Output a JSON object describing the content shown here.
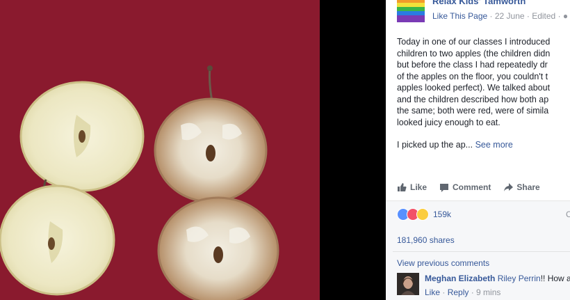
{
  "post": {
    "page_name": "Relax Kids' Tamworth",
    "like_page": "Like This Page",
    "meta_rest": " · 22 June · Edited · ",
    "paragraph_lines": [
      "Today in one of our classes I introduced",
      "children to two apples (the children didn",
      "but before the class I had repeatedly dr",
      "of the apples on the floor, you couldn't t",
      "apples looked perfect). We talked about",
      "and the children described how both ap",
      "the same; both were red, were of simila",
      "looked juicy enough to eat."
    ],
    "teaser": "I picked up the ap...",
    "see_more": "See more"
  },
  "actions": {
    "like": "Like",
    "comment": "Comment",
    "share": "Share"
  },
  "stats": {
    "reaction_count": "159k",
    "side_letter": "C",
    "shares": "181,960 shares"
  },
  "comments": {
    "view_previous": "View previous comments",
    "author": "Meghan Elizabeth",
    "tagged": "Riley Perrin",
    "text": "!! How a",
    "like": "Like",
    "reply": "Reply",
    "time": "9 mins"
  },
  "colors": {
    "facebook_blue": "#365899",
    "photo_background": "#8a1a2e",
    "like_blue": "#5890ff",
    "love_red": "#f25268",
    "sad_yellow": "#fbcd3f"
  }
}
